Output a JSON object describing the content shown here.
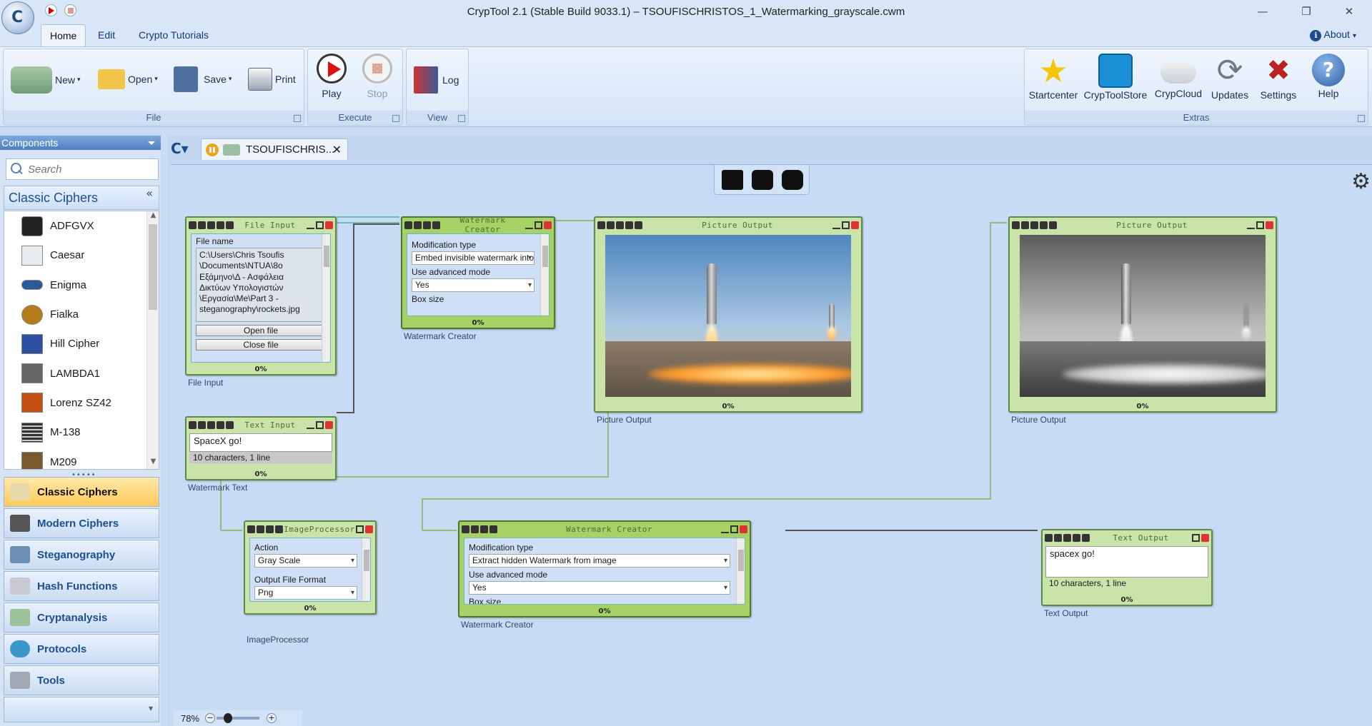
{
  "window": {
    "title": "CrypTool 2.1 (Stable Build 9033.1) – TSOUFISCHRISTOS_1_Watermarking_grayscale.cwm"
  },
  "menu": {
    "tabs": [
      "Home",
      "Edit",
      "Crypto Tutorials"
    ],
    "about": "About"
  },
  "ribbon": {
    "file": {
      "label": "File",
      "new": "New",
      "open": "Open",
      "save": "Save",
      "print": "Print"
    },
    "execute": {
      "label": "Execute",
      "play": "Play",
      "stop": "Stop"
    },
    "view": {
      "label": "View",
      "log": "Log"
    },
    "extras": {
      "label": "Extras",
      "items": [
        "Startcenter",
        "CrypToolStore",
        "CrypCloud",
        "Updates",
        "Settings",
        "Help"
      ]
    }
  },
  "components": {
    "header": "Components",
    "search_placeholder": "Search",
    "category": "Classic Ciphers",
    "items": [
      "ADFGVX",
      "Caesar",
      "Enigma",
      "Fialka",
      "Hill Cipher",
      "LAMBDA1",
      "Lorenz SZ42",
      "M-138",
      "M209"
    ],
    "nav": [
      "Classic Ciphers",
      "Modern Ciphers",
      "Steganography",
      "Hash Functions",
      "Cryptanalysis",
      "Protocols",
      "Tools"
    ]
  },
  "document": {
    "tab_title": "TSOUFISCHRIS...",
    "zoom": "78%"
  },
  "plugins": {
    "file_input": {
      "title": "File Input",
      "caption": "File Input",
      "field_label": "File name",
      "path_lines": [
        "C:\\Users\\Chris Tsoufis",
        "\\Documents\\NTUA\\8o",
        "Εξάμηνο\\Δ - Ασφάλεια",
        "Δικτύων Υπολογιστών",
        "\\Εργασία\\Me\\Part 3 -",
        "steganography\\rockets.jpg"
      ],
      "open_btn": "Open file",
      "close_btn": "Close file",
      "progress": "0%"
    },
    "text_input": {
      "title": "Text Input",
      "caption": "Watermark Text",
      "text": "SpaceX go!",
      "status": "10 characters,  1 line",
      "progress": "0%"
    },
    "wm_creator_1": {
      "title": "Watermark Creator",
      "caption": "Watermark Creator",
      "mod_label": "Modification type",
      "mod_value": "Embed invisible watermark into the i",
      "adv_label": "Use advanced mode",
      "adv_value": "Yes",
      "box_label": "Box size",
      "progress": "0%"
    },
    "picture_1": {
      "title": "Picture Output",
      "caption": "Picture Output",
      "progress": "0%"
    },
    "picture_2": {
      "title": "Picture Output",
      "caption": "Picture Output",
      "progress": "0%"
    },
    "image_processor": {
      "title": "ImageProcessor",
      "caption": "ImageProcessor",
      "action_label": "Action",
      "action_value": "Gray Scale",
      "format_label": "Output File Format",
      "format_value": "Png",
      "progress": "0%"
    },
    "wm_creator_2": {
      "title": "Watermark Creator",
      "caption": "Watermark Creator",
      "mod_label": "Modification type",
      "mod_value": "Extract hidden Watermark from image",
      "adv_label": "Use advanced mode",
      "adv_value": "Yes",
      "box_label": "Box size",
      "progress": "0%"
    },
    "text_output": {
      "title": "Text Output",
      "caption": "Text Output",
      "text": "spacex go!",
      "status": "10 characters,  1 line",
      "progress": "0%"
    }
  }
}
